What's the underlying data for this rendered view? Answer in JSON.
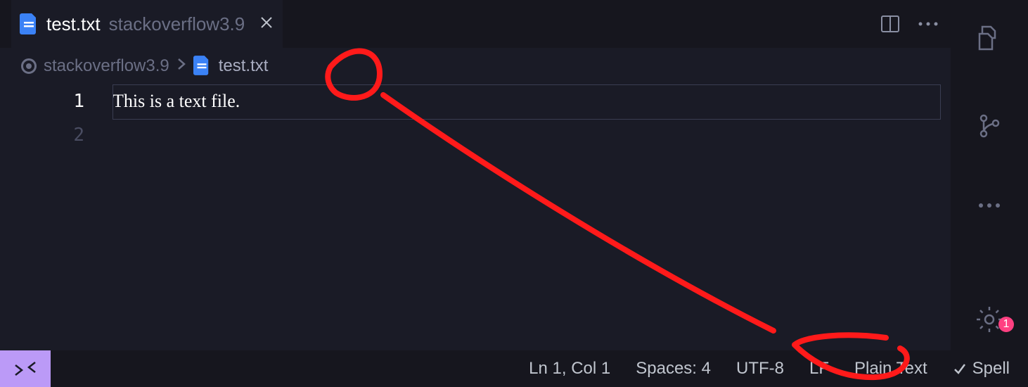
{
  "tab": {
    "filename": "test.txt",
    "subtitle": "stackoverflow3.9"
  },
  "breadcrumb": {
    "folder": "stackoverflow3.9",
    "file": "test.txt"
  },
  "editor": {
    "lines": {
      "0": "1",
      "1": "2"
    },
    "content": {
      "0": "This is a text file."
    }
  },
  "status": {
    "lncol": "Ln 1, Col 1",
    "spaces": "Spaces: 4",
    "encoding": "UTF-8",
    "eol": "LF",
    "language": "Plain Text",
    "spell": "Spell"
  },
  "badge": {
    "settings": "1"
  }
}
